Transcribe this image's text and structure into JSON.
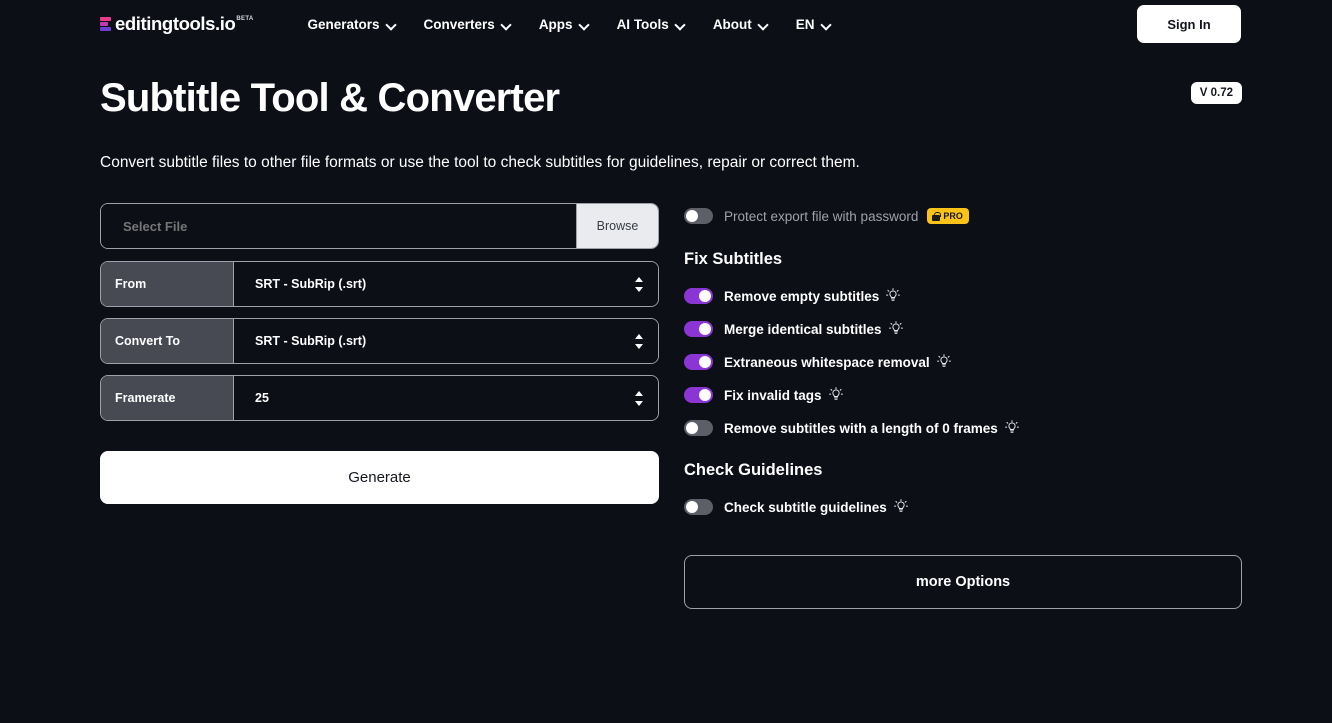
{
  "header": {
    "logo_text": "editingtools.io",
    "logo_badge": "BETA",
    "nav": [
      {
        "label": "Generators"
      },
      {
        "label": "Converters"
      },
      {
        "label": "Apps"
      },
      {
        "label": "AI Tools"
      },
      {
        "label": "About"
      },
      {
        "label": "EN"
      }
    ],
    "sign_in": "Sign In"
  },
  "page": {
    "title": "Subtitle Tool & Converter",
    "version": "V 0.72",
    "description": "Convert subtitle files to other file formats or use the tool to check subtitles for guidelines, repair or correct them."
  },
  "form": {
    "file": {
      "placeholder": "Select File",
      "value": "",
      "browse_label": "Browse"
    },
    "selects": [
      {
        "label": "From",
        "value": "SRT - SubRip (.srt)"
      },
      {
        "label": "Convert To",
        "value": "SRT - SubRip (.srt)"
      },
      {
        "label": "Framerate",
        "value": "25"
      }
    ],
    "generate_label": "Generate"
  },
  "options": {
    "protect": {
      "label": "Protect export file with password",
      "state": "off",
      "badge": "PRO"
    },
    "fix_subtitles_title": "Fix Subtitles",
    "fix_subtitles": [
      {
        "label": "Remove empty subtitles",
        "state": "on"
      },
      {
        "label": "Merge identical subtitles",
        "state": "on"
      },
      {
        "label": "Extraneous whitespace removal",
        "state": "on"
      },
      {
        "label": "Fix invalid tags",
        "state": "on"
      },
      {
        "label": "Remove subtitles with a length of 0 frames",
        "state": "off"
      }
    ],
    "check_guidelines_title": "Check Guidelines",
    "check_guidelines": [
      {
        "label": "Check subtitle guidelines",
        "state": "off"
      }
    ],
    "more_options_label": "more Options"
  },
  "colors": {
    "background": "#0d0f17",
    "toggle_on": "#8b36d4",
    "toggle_off": "#5c5f68",
    "pro_badge": "#fbc318",
    "accent_pink": "#e93b8a",
    "accent_purple": "#6b3ed6",
    "border": "#9ea1ab"
  }
}
